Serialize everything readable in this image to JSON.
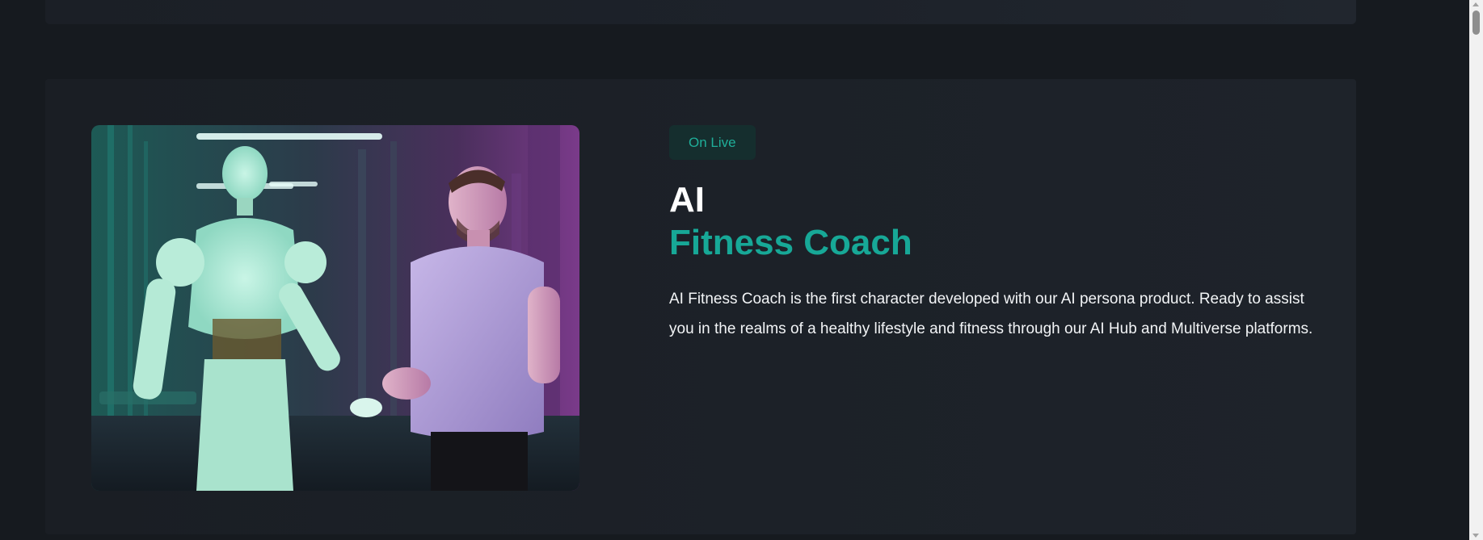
{
  "feature": {
    "badge": "On Live",
    "title_line1": "AI",
    "title_line2": "Fitness Coach",
    "description": "AI Fitness Coach is the first character developed with our AI persona product. Ready to assist you in the realms of a healthy lifestyle and fitness through our AI Hub and Multiverse platforms.",
    "image_icon": "robot-and-man-gym-image"
  },
  "colors": {
    "page_bg": "#161a1f",
    "card_bg": "#1c2128",
    "accent": "#17a897",
    "badge_bg": "#152e2e",
    "badge_text": "#1fae99"
  }
}
